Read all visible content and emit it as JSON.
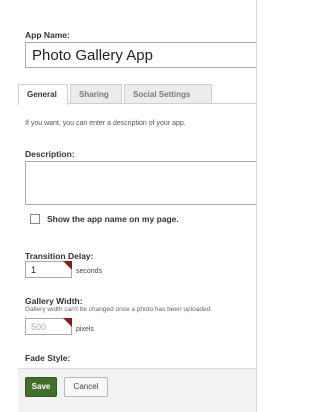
{
  "app_name": {
    "label": "App Name:",
    "value": "Photo Gallery App"
  },
  "tabs": [
    {
      "label": "General",
      "active": true
    },
    {
      "label": "Sharing",
      "active": false
    },
    {
      "label": "Social Settings",
      "active": false
    }
  ],
  "hint": "If you want, you can enter a description of your app.",
  "description": {
    "label": "Description:",
    "value": ""
  },
  "show_name": {
    "label": "Show the app name on my page.",
    "checked": false
  },
  "transition": {
    "label": "Transition Delay:",
    "value": "1",
    "unit": "seconds"
  },
  "gallery": {
    "label": "Gallery Width:",
    "note": "Gallery width can't be changed once a photo has been uploaded.",
    "value": "500",
    "unit": "pixels"
  },
  "fade": {
    "label": "Fade Style:"
  },
  "footer": {
    "save_label": "Save",
    "cancel_label": "Cancel"
  },
  "colors": {
    "save_bg": "#3f6f2a",
    "accent_corner": "#8b1a1a"
  }
}
